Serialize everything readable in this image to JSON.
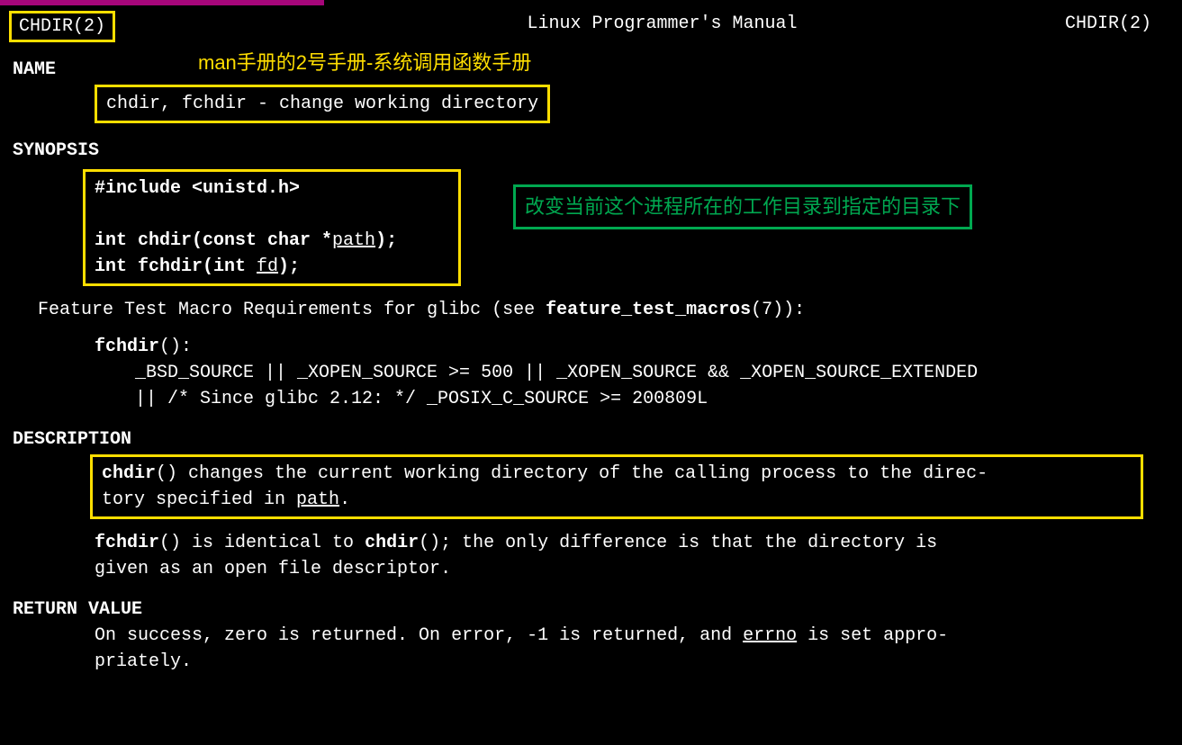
{
  "header": {
    "left": "CHDIR(2)",
    "center": "Linux Programmer's Manual",
    "right": "CHDIR(2)"
  },
  "annotations": {
    "yellow_top": "man手册的2号手册-系统调用函数手册",
    "green_box": "改变当前这个进程所在的工作目录到指定的目录下"
  },
  "sections": {
    "name_heading": "NAME",
    "name_text": "chdir, fchdir - change working directory",
    "synopsis_heading": "SYNOPSIS",
    "synopsis": {
      "include": "#include <unistd.h>",
      "proto1_a": "int chdir(const char *",
      "proto1_u": "path",
      "proto1_b": ");",
      "proto2_a": "int fchdir(int ",
      "proto2_u": "fd",
      "proto2_b": ");"
    },
    "ftm_intro_a": "Feature Test Macro Requirements for glibc (see ",
    "ftm_intro_b": "feature_test_macros",
    "ftm_intro_c": "(7)):",
    "ftm_func": "fchdir",
    "ftm_func_paren": "():",
    "ftm_line1": "_BSD_SOURCE || _XOPEN_SOURCE >= 500 || _XOPEN_SOURCE && _XOPEN_SOURCE_EXTENDED",
    "ftm_line2": "|| /* Since glibc 2.12: */ _POSIX_C_SOURCE >= 200809L",
    "description_heading": "DESCRIPTION",
    "desc_box_a": "chdir",
    "desc_box_b": "() changes the current working directory of the calling process to the direc-",
    "desc_box_c": "tory specified in ",
    "desc_box_d": "path",
    "desc_box_e": ".",
    "desc2_a": "fchdir",
    "desc2_b": "() is identical to ",
    "desc2_c": "chdir",
    "desc2_d": "(); the only difference is  that  the  directory  is",
    "desc2_e": "given as an open file descriptor.",
    "return_heading": "RETURN VALUE",
    "ret_a": "On  success,  zero is returned.  On error, -1 is returned, and ",
    "ret_b": "errno",
    "ret_c": " is set appro-",
    "ret_d": "priately."
  }
}
